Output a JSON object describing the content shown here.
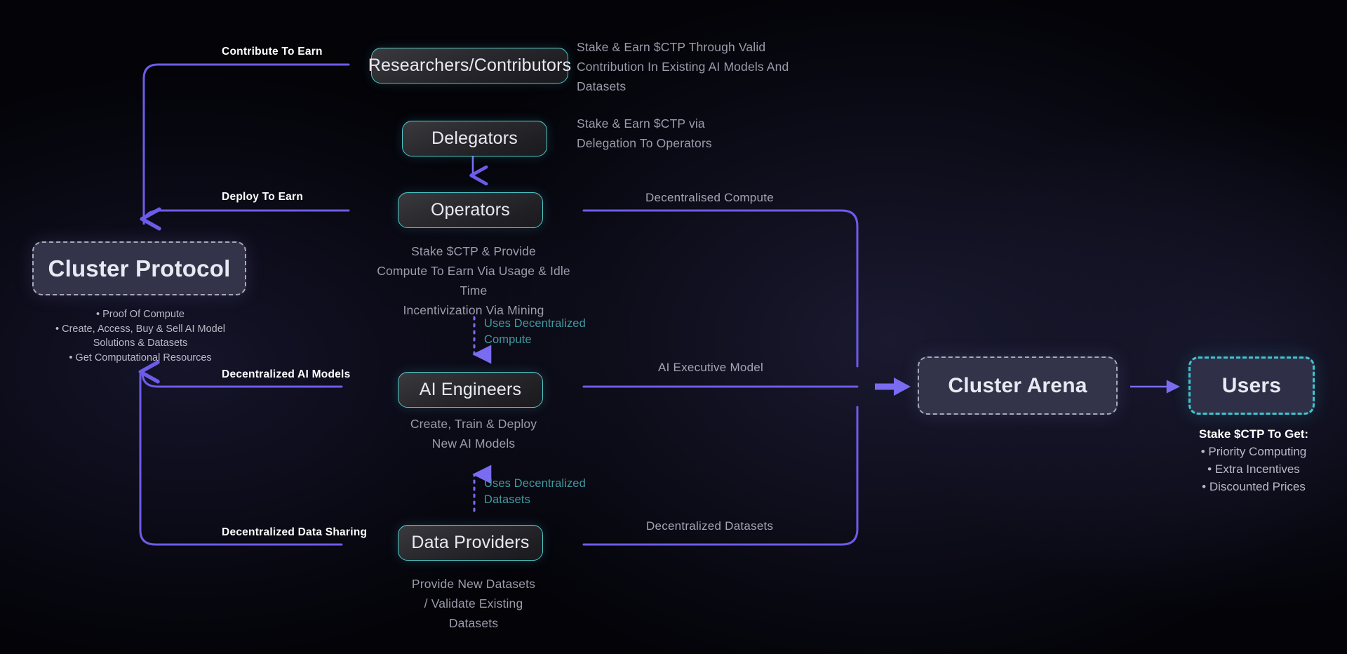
{
  "diagram": {
    "title": "Cluster Protocol Ecosystem Flow",
    "colors": {
      "accent_purple": "#6c5ce7",
      "accent_teal": "#4fc8c8",
      "note_teal": "#3f9aa0",
      "background": "#030308",
      "box_fill": "#2b2b2f",
      "dashed_fill": "#33334a",
      "text_primary": "#e9e9f2",
      "text_secondary": "#9b9bab"
    }
  },
  "nodes": {
    "cluster_protocol": {
      "label": "Cluster Protocol",
      "style": "dashed-gray"
    },
    "researchers": {
      "label": "Researchers/Contributors",
      "style": "teal"
    },
    "delegators": {
      "label": "Delegators",
      "style": "teal"
    },
    "operators": {
      "label": "Operators",
      "style": "teal"
    },
    "ai_engineers": {
      "label": "AI Engineers",
      "style": "teal"
    },
    "data_providers": {
      "label": "Data Providers",
      "style": "teal"
    },
    "cluster_arena": {
      "label": "Cluster Arena",
      "style": "dashed-gray"
    },
    "users": {
      "label": "Users",
      "style": "dashed-teal"
    }
  },
  "descriptions": {
    "researchers": "Stake & Earn $CTP Through Valid Contribution In Existing AI Models And Datasets",
    "researchers_lines": [
      "Stake & Earn $CTP Through Valid",
      "Contribution In Existing AI Models And",
      "Datasets"
    ],
    "delegators_lines": [
      "Stake & Earn $CTP via",
      "Delegation To Operators"
    ],
    "operators_lines": [
      "Stake $CTP & Provide",
      "Compute To Earn Via Usage & Idle Time",
      "Incentivization Via Mining"
    ],
    "ai_engineers_lines": [
      "Create, Train & Deploy",
      "New AI Models"
    ],
    "data_providers_lines": [
      "Provide New Datasets",
      "/ Validate Existing",
      "Datasets"
    ]
  },
  "edge_labels": {
    "contribute_to_earn": "Contribute To Earn",
    "deploy_to_earn": "Deploy To Earn",
    "decentralized_ai_models": "Decentralized AI Models",
    "decentralized_data_sharing": "Decentralized Data Sharing",
    "decentralised_compute": "Decentralised Compute",
    "ai_executive_model": "AI Executive Model",
    "decentralized_datasets": "Decentralized Datasets"
  },
  "notes": {
    "uses_decentralized_compute_lines": [
      "Uses Decentralized",
      "Compute"
    ],
    "uses_decentralized_datasets_lines": [
      "Uses Decentralized",
      "Datasets"
    ]
  },
  "protocol_bullets": [
    "Proof Of Compute",
    "Create, Access, Buy & Sell AI Model",
    "Solutions & Datasets",
    "Get Computational Resources"
  ],
  "users_benefits": {
    "heading": "Stake $CTP To Get:",
    "items": [
      "Priority Computing",
      "Extra Incentives",
      "Discounted Prices"
    ]
  }
}
